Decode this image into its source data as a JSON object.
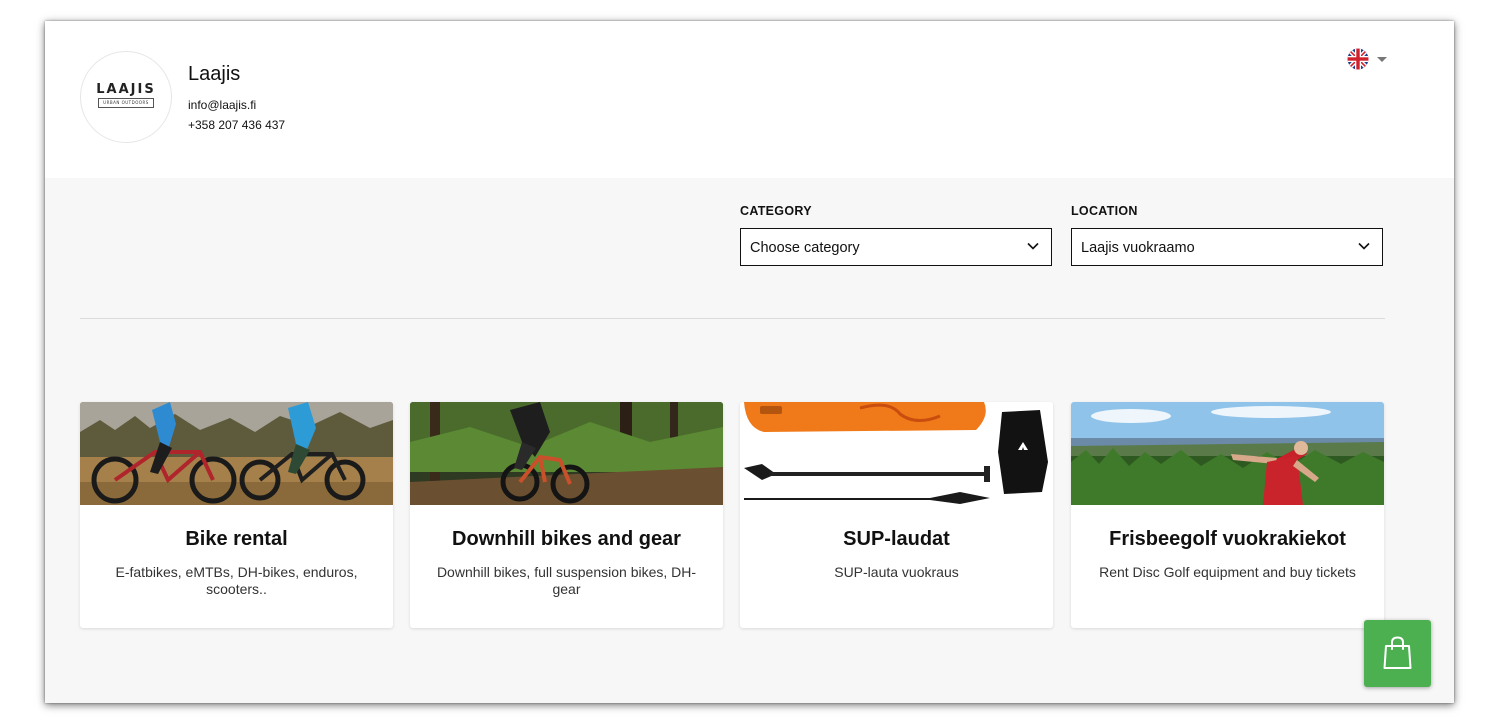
{
  "shop": {
    "logo_text": "LAAJIS",
    "logo_subtext": "URBAN OUTDOORS",
    "name": "Laajis",
    "email": "info@laajis.fi",
    "phone": "+358 207 436 437"
  },
  "language": {
    "selected_icon": "uk-flag-icon"
  },
  "filters": {
    "category": {
      "label": "CATEGORY",
      "value": "Choose category"
    },
    "location": {
      "label": "LOCATION",
      "value": "Laajis vuokraamo"
    }
  },
  "cards": [
    {
      "title": "Bike rental",
      "description": "E-fatbikes, eMTBs, DH-bikes, enduros, scooters.."
    },
    {
      "title": "Downhill bikes and gear",
      "description": "Downhill bikes, full suspension bikes, DH-gear"
    },
    {
      "title": "SUP-laudat",
      "description": "SUP-lauta vuokraus"
    },
    {
      "title": "Frisbeegolf vuokrakiekot",
      "description": "Rent Disc Golf equipment and buy tickets"
    }
  ],
  "cart": {
    "icon": "shopping-bag-icon",
    "color": "#4caf50"
  },
  "colors": {
    "page_bg": "#f7f7f7",
    "header_bg": "#ffffff",
    "accent": "#4caf50"
  }
}
